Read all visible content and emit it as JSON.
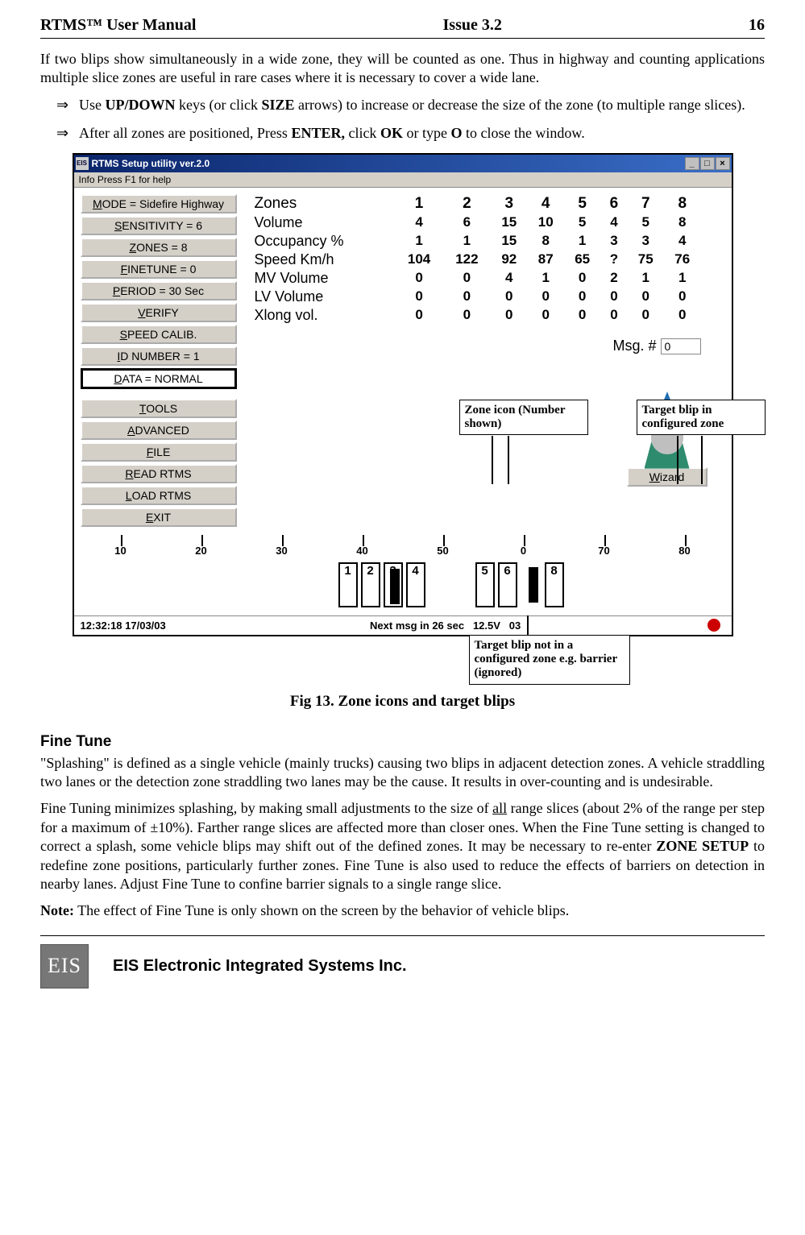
{
  "header": {
    "left": "RTMS™ User Manual",
    "center": "Issue 3.2",
    "right": "16"
  },
  "p1": "If two blips show simultaneously in a wide zone, they will be counted as one.  Thus in highway and counting applications multiple slice zones are useful in rare cases where it is necessary to cover a wide lane.",
  "bullets": {
    "b1_pre": "Use ",
    "b1_k1": "UP/DOWN",
    "b1_mid": " keys (or click ",
    "b1_k2": "SIZE",
    "b1_post": " arrows) to increase or decrease the size of the zone (to multiple range slices).",
    "b2_pre": "After all zones are positioned, Press ",
    "b2_k1": "ENTER,",
    "b2_mid": " click ",
    "b2_k2": "OK",
    "b2_mid2": " or type ",
    "b2_k3": "O",
    "b2_post": " to close the window."
  },
  "window": {
    "title": "RTMS Setup utility ver.2.0",
    "title_icon": "EIS",
    "menubar": "Info    Press F1 for help",
    "buttons": [
      "MODE = Sidefire Highway",
      "SENSITIVITY = 6",
      "ZONES = 8",
      "FINETUNE = 0",
      "PERIOD = 30 Sec",
      "VERIFY",
      "SPEED CALIB.",
      "ID NUMBER = 1",
      "DATA = NORMAL",
      "TOOLS",
      "ADVANCED",
      "FILE",
      "READ RTMS",
      "LOAD RTMS",
      "EXIT"
    ],
    "data_btn_index": 8,
    "rows": [
      {
        "label": "Zones",
        "vals": [
          "1",
          "2",
          "3",
          "4",
          "5",
          "6",
          "7",
          "8"
        ]
      },
      {
        "label": "Volume",
        "vals": [
          "4",
          "6",
          "15",
          "10",
          "5",
          "4",
          "5",
          "8"
        ]
      },
      {
        "label": "Occupancy %",
        "vals": [
          "1",
          "1",
          "15",
          "8",
          "1",
          "3",
          "3",
          "4"
        ]
      },
      {
        "label": "Speed Km/h",
        "vals": [
          "104",
          "122",
          "92",
          "87",
          "65",
          "?",
          "75",
          "76"
        ]
      },
      {
        "label": "MV Volume",
        "vals": [
          "0",
          "0",
          "4",
          "1",
          "0",
          "2",
          "1",
          "1"
        ]
      },
      {
        "label": "LV Volume",
        "vals": [
          "0",
          "0",
          "0",
          "0",
          "0",
          "0",
          "0",
          "0"
        ]
      },
      {
        "label": "Xlong vol.",
        "vals": [
          "0",
          "0",
          "0",
          "0",
          "0",
          "0",
          "0",
          "0"
        ]
      }
    ],
    "msg_label": "Msg. #",
    "msg_value": "0",
    "wizard_btn": "Wizard",
    "ruler_labels": [
      "10",
      "20",
      "30",
      "40",
      "50",
      "0",
      "70",
      "80"
    ],
    "zones": [
      "1",
      "2",
      "3",
      "4",
      "5",
      "6",
      "8"
    ],
    "status": {
      "time": "12:32:18   17/03/03",
      "next": "Next msg in 26 sec",
      "volts": "12.5V",
      "extra": "03"
    }
  },
  "callouts": {
    "c1": "Zone icon (Number shown)",
    "c2": "Target blip  in configured zone",
    "c3": "Target blip not in a configured zone  e.g. barrier (ignored)"
  },
  "fig_caption": "Fig 13.      Zone icons and target blips",
  "section_heading": "Fine Tune",
  "p2": "\"Splashing\" is defined as a single vehicle (mainly trucks)  causing two blips in adjacent detection zones. A vehicle straddling two lanes or the detection zone straddling two lanes may be the cause. It results in over-counting and is undesirable.",
  "p3_pre": "Fine Tuning minimizes splashing, by making small adjustments to the size of ",
  "p3_ul": "all",
  "p3_mid": " range slices (about 2% of the range per step for a maximum of ±10%). Farther range slices are affected more than closer ones. When the Fine Tune setting is changed to correct a splash, some vehicle blips may shift out of the defined zones. It may be necessary to re-enter ",
  "p3_b": "ZONE SETUP",
  "p3_post": " to redefine zone positions, particularly further zones. Fine Tune is also used to reduce the effects of barriers on detection in nearby lanes. Adjust Fine Tune to confine barrier signals to a single range slice.",
  "note_label": "Note:",
  "note_text": " The effect of Fine Tune is only shown on the screen by the behavior of vehicle blips.",
  "footer": {
    "logo": "EIS",
    "company": "EIS Electronic Integrated Systems Inc."
  }
}
